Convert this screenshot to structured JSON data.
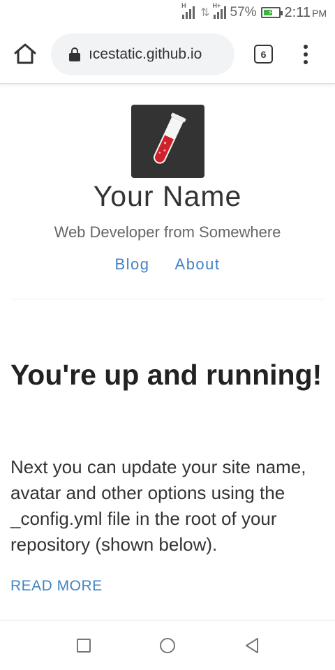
{
  "status_bar": {
    "signal1_tag": "H",
    "signal2_tag": "H+",
    "data_arrows": "⇅",
    "battery_percent": "57%",
    "battery_level": 0.57,
    "time": "2:11",
    "ampm": "PM"
  },
  "browser": {
    "url": "ıcestatic.github.io",
    "tab_count": "6",
    "icons": [
      "home-icon",
      "lock-icon",
      "tabs-icon",
      "overflow-menu-icon"
    ]
  },
  "site": {
    "name": "Your Name",
    "tagline": "Web Developer from Somewhere",
    "nav": [
      "Blog",
      "About"
    ]
  },
  "post": {
    "title": "You're up and running!",
    "excerpt": "Next you can update your site name, avatar and other options using the _config.yml file in the root of your repository (shown below).",
    "read_more": "READ MORE"
  },
  "nav_bar": {
    "icons": [
      "recents-icon",
      "home-circle-icon",
      "back-icon"
    ]
  },
  "colors": {
    "accent": "#4183c4",
    "avatar_bg": "#333333",
    "battery_green": "#3bb43b"
  }
}
